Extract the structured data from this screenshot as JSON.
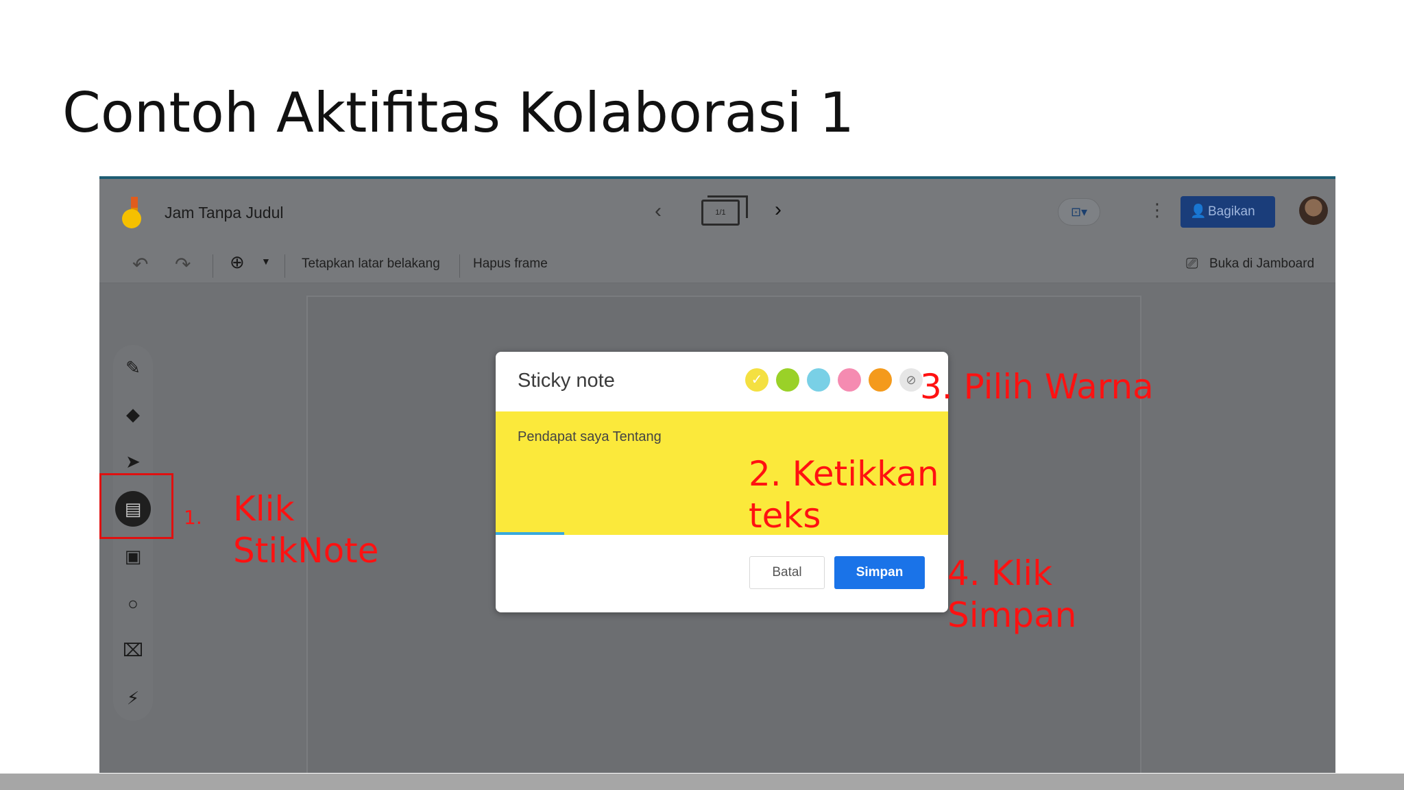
{
  "slide": {
    "title": "Contoh Aktifitas Kolaborasi 1"
  },
  "app": {
    "doc_title": "Jam Tanpa Judul",
    "frame_counter": "1/1",
    "share_label": "Bagikan",
    "open_label": "Buka di Jamboard"
  },
  "toolbar": {
    "set_background": "Tetapkan latar belakang",
    "delete_frame": "Hapus frame"
  },
  "dialog": {
    "title": "Sticky note",
    "note_text": "Pendapat saya Tentang",
    "cancel_label": "Batal",
    "save_label": "Simpan",
    "colors": [
      "#f4e041",
      "#9ad128",
      "#79d0e6",
      "#f58bb1",
      "#f49a1c"
    ],
    "selected_color_index": 0
  },
  "annotations": {
    "step1_number": "1.",
    "step1_line1": "Klik",
    "step1_line2": "StikNote",
    "step2_line1": "2. Ketikkan",
    "step2_line2": "teks",
    "step3": "3. Pilih Warna",
    "step4_line1": "4. Klik",
    "step4_line2": "Simpan",
    "highlight_color": "#ff1111"
  },
  "icons": {
    "sidebar_tools": [
      "pen-icon",
      "eraser-icon",
      "select-icon",
      "sticky-note-icon",
      "image-icon",
      "circle-icon",
      "text-box-icon",
      "laser-icon"
    ]
  }
}
